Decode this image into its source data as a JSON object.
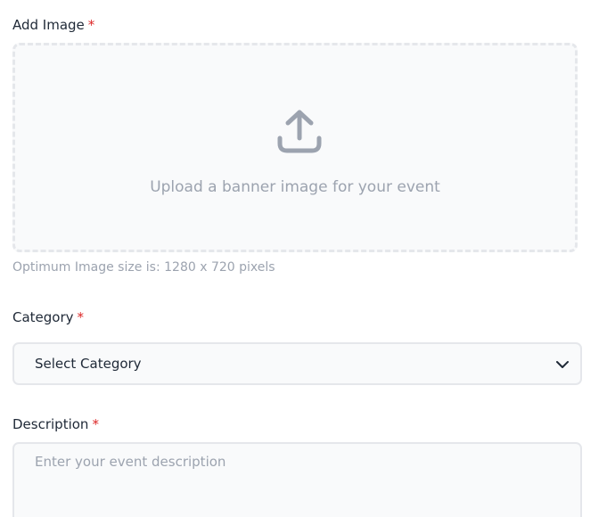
{
  "image_field": {
    "label": "Add Image",
    "required_mark": "*",
    "upload_icon": "upload-icon",
    "dropzone_text": "Upload a banner image for your event",
    "hint": "Optimum Image size is: 1280 x 720 pixels"
  },
  "category_field": {
    "label": "Category",
    "required_mark": "*",
    "selected_value": "Select Category",
    "chevron_icon": "chevron-down-icon"
  },
  "description_field": {
    "label": "Description",
    "required_mark": "*",
    "value": "",
    "placeholder": "Enter your event description"
  },
  "colors": {
    "required": "#dc2626",
    "muted_text": "#9ca3af",
    "border": "#e5e7eb",
    "field_background": "#f9fafb"
  }
}
